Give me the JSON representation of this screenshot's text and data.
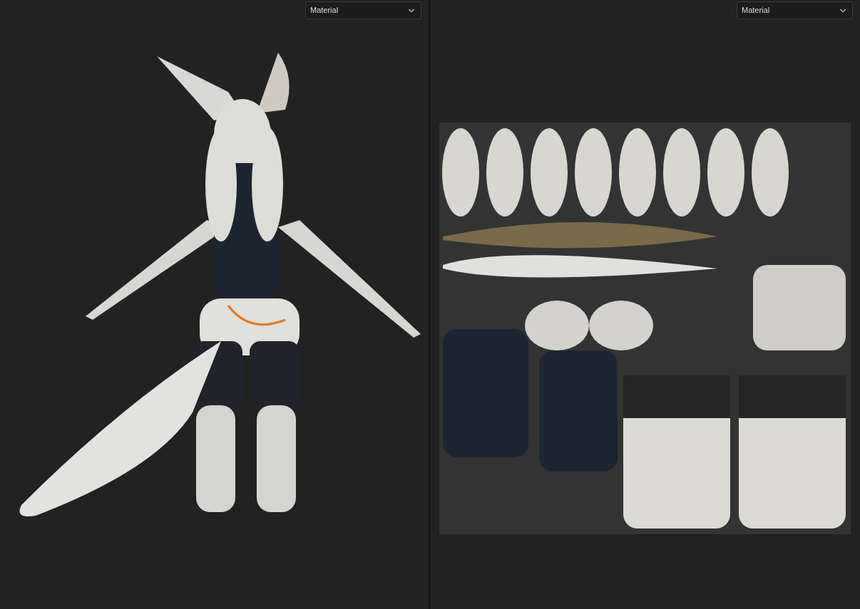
{
  "viewports": [
    {
      "kind": "model",
      "view_mode": "Material"
    },
    {
      "kind": "uv",
      "view_mode": "Material"
    }
  ]
}
